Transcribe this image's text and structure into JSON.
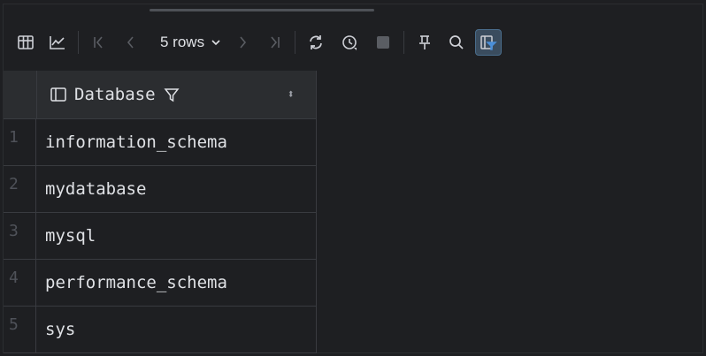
{
  "toolbar": {
    "rows_label": "5 rows",
    "icons": [
      "table-view-icon",
      "chart-view-icon",
      "first-page-icon",
      "prev-page-icon",
      "chevron-down-icon",
      "next-page-icon",
      "last-page-icon",
      "refresh-icon",
      "history-icon",
      "stop-icon",
      "pin-icon",
      "search-icon",
      "filter-panel-icon"
    ],
    "accent": "#4a8fd9"
  },
  "grid": {
    "column_header": "Database",
    "rows": [
      {
        "num": "1",
        "value": "information_schema"
      },
      {
        "num": "2",
        "value": "mydatabase"
      },
      {
        "num": "3",
        "value": "mysql"
      },
      {
        "num": "4",
        "value": "performance_schema"
      },
      {
        "num": "5",
        "value": "sys"
      }
    ]
  }
}
